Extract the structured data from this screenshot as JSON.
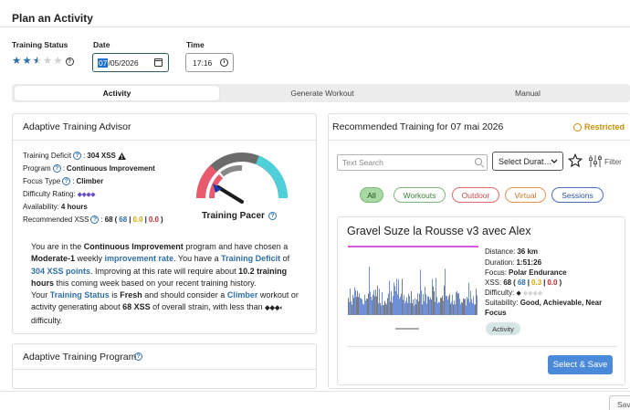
{
  "page": {
    "title": "Plan an Activity"
  },
  "form": {
    "training_status_label": "Training Status",
    "training_status_stars": 2.5,
    "date_label": "Date",
    "date_month": "07",
    "date_rest": "/05/2026",
    "time_label": "Time",
    "time_value": "17:16"
  },
  "tabs": [
    {
      "label": "Activity",
      "active": true
    },
    {
      "label": "Generate Workout",
      "active": false
    },
    {
      "label": "Manual",
      "active": false
    }
  ],
  "advisor": {
    "title": "Adaptive Training Advisor",
    "deficit_label": "Training Deficit",
    "deficit_value": "304 XSS",
    "program_label": "Program",
    "program_value": "Continuous Improvement",
    "focus_label": "Focus Type",
    "focus_value": "Climber",
    "difficulty_label": "Difficulty Rating:",
    "difficulty_value": "◆◆◆◆",
    "availability_label": "Availability:",
    "availability_value": "4 hours",
    "rec_label": "Recommended XSS",
    "rec_total": "68",
    "rec_blue": "68",
    "rec_yellow": "0.0",
    "rec_red": "0.0",
    "pacer_label": "Training Pacer",
    "paragraph": {
      "t1": "You are in the ",
      "l1": "Continuous Improvement",
      "t2": " program and have chosen a ",
      "b1": "Moderate-1",
      "t3": " weekly ",
      "l2": "improvement rate",
      "t4": ". You have a ",
      "l3": "Training Deficit",
      "t5": " of ",
      "l4": "304 XSS points",
      "t6": ". Improving at this rate will require about ",
      "b2": "10.2 training hours",
      "t7": " this coming week based on your recent training history.",
      "t8": "Your ",
      "l5": "Training Status",
      "t9": " is ",
      "b3": "Fresh",
      "t10": " and should consider a ",
      "l6": "Climber",
      "t11": " workout or activity generating about ",
      "b4": "68 XSS",
      "t12": " of overall strain, with less than ",
      "b5": "◆◆◆◐",
      "t13": " difficulty."
    }
  },
  "program_card": {
    "title": "Adaptive Training Program"
  },
  "recommended": {
    "title": "Recommended Training for 07 mai 2026",
    "restricted": "Restricted",
    "search_placeholder": "Text Search",
    "duration_select": "Select Durat…",
    "filter_label": "Filter",
    "pills": [
      "All",
      "Workouts",
      "Outdoor",
      "Virtual",
      "Sessions"
    ],
    "workout": {
      "name": "Gravel Suze la Rousse v3 avec Alex",
      "distance_label": "Distance:",
      "distance": "36 km",
      "duration_label": "Duration:",
      "duration": "1:51:26",
      "focus_label": "Focus:",
      "focus": "Polar Endurance",
      "xss_label": "XSS:",
      "xss_total": "68",
      "xss_blue": "68",
      "xss_yellow": "0.3",
      "xss_red": "0.0",
      "difficulty_label": "Difficulty:",
      "suitability_label": "Suitability:",
      "suitability": "Good, Achievable, Near Focus",
      "tag": "Activity",
      "select_button": "Select & Save"
    }
  },
  "footer": {
    "save_button": "Save"
  },
  "colors": {
    "accent": "#2f6faa",
    "pacer_red": "#ea5a6e",
    "pacer_cyan": "#4fd0d8",
    "pacer_gray": "#6b6b6b",
    "button_blue": "#4a8ad8"
  }
}
